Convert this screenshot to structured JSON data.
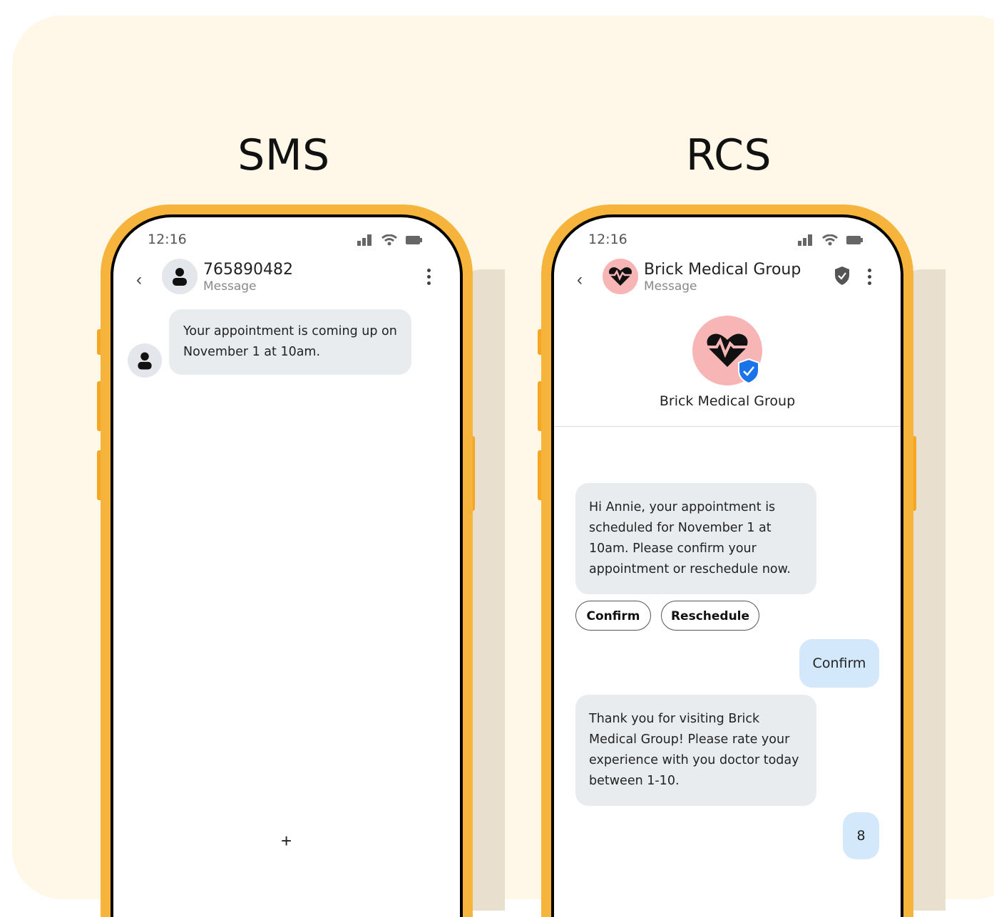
{
  "headings": {
    "left": "SMS",
    "right": "RCS"
  },
  "sms": {
    "time": "12:16",
    "contact_name": "765890482",
    "contact_sub": "Message",
    "message": "Your appointment is coming up on November  1 at 10am.",
    "compose_icon": "+"
  },
  "rcs": {
    "time": "12:16",
    "contact_name": "Brick Medical Group",
    "contact_sub": "Message",
    "profile_name": "Brick Medical Group",
    "message1": "Hi Annie, your appointment is scheduled for November 1 at 10am. Please confirm your appointment or reschedule now.",
    "chip_confirm": "Confirm",
    "chip_reschedule": "Reschedule",
    "reply1": "Confirm",
    "message2": "Thank you for visiting Brick Medical Group! Please rate your experience with you doctor today between 1-10.",
    "reply2": "8"
  },
  "colors": {
    "panel_bg": "#fff8e9",
    "phone_frame": "#f6b43c",
    "incoming_bubble": "#e9ecef",
    "outgoing_bubble": "#d3e8fb",
    "brand_avatar_bg": "#f7b5b5",
    "verified_badge": "#1a73e8"
  },
  "icons": [
    "back-chevron-icon",
    "person-icon",
    "heart-pulse-icon",
    "verified-shield-icon",
    "more-vert-icon",
    "signal-icon",
    "wifi-icon",
    "battery-icon",
    "plus-icon"
  ]
}
